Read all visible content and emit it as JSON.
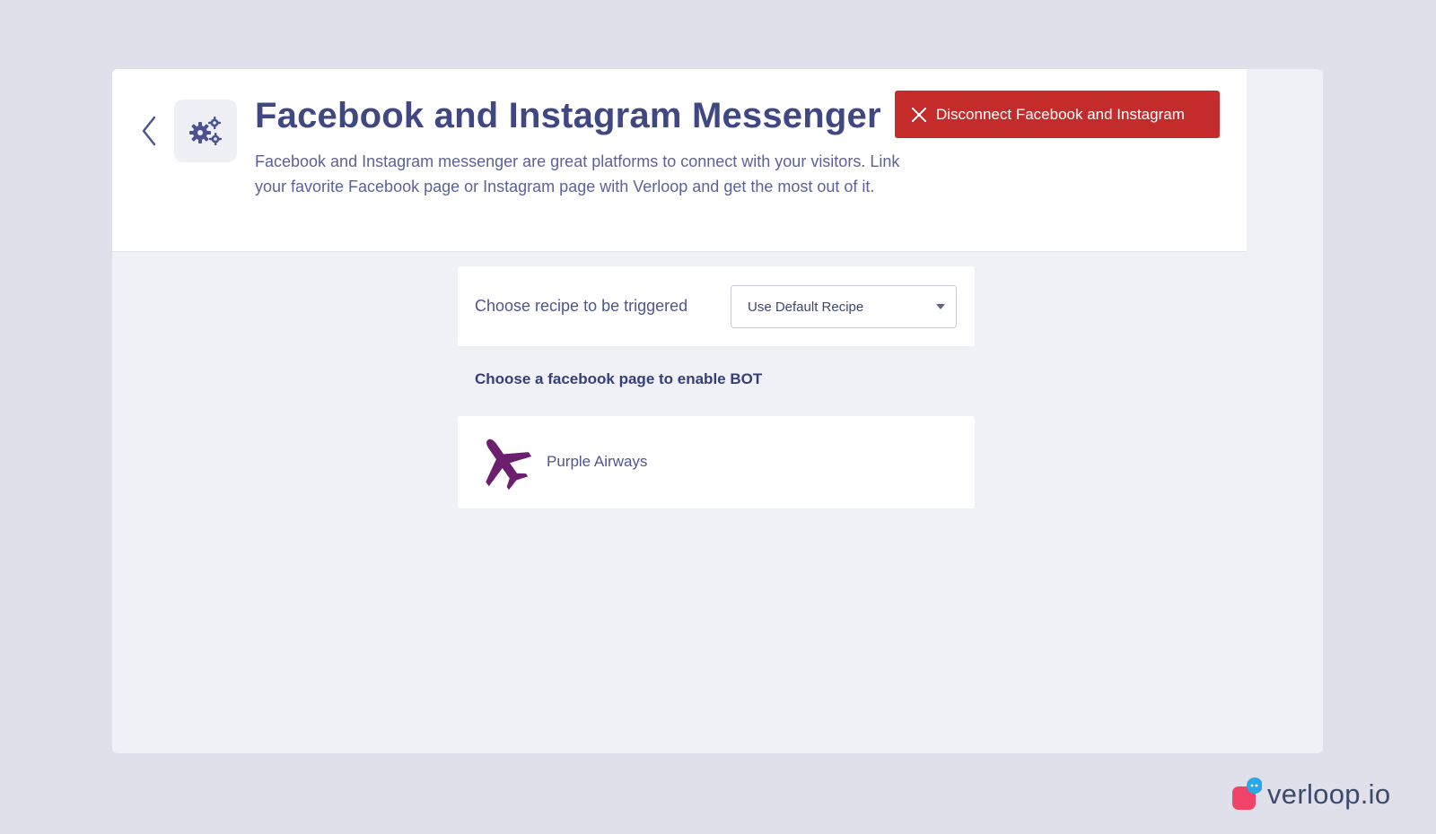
{
  "header": {
    "title": "Facebook and Instagram Messenger",
    "description": "Facebook and Instagram messenger are great platforms to connect with your visitors. Link your favorite Facebook page or Instagram page with Verloop and get the most out of it.",
    "disconnect_label": "Disconnect Facebook and Instagram",
    "back_icon": "chevron-left-icon",
    "settings_icon": "gears-icon"
  },
  "recipe": {
    "label": "Choose recipe to be triggered",
    "selected": "Use Default Recipe"
  },
  "facebook": {
    "heading": "Choose a facebook page to enable BOT",
    "pages": [
      {
        "name": "Purple Airways",
        "icon": "airplane-icon"
      }
    ]
  },
  "brand": {
    "name": "verloop.io"
  },
  "colors": {
    "accent": "#3f4883",
    "danger": "#c42b2b",
    "page_icon": "#6b1f6e",
    "background": "#dfe0ea"
  }
}
